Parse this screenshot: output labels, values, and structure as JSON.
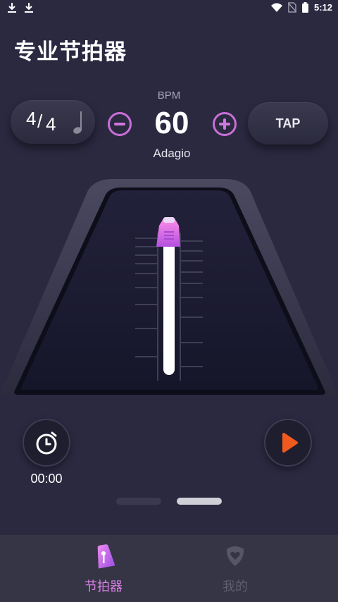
{
  "status_bar": {
    "left_icons": [
      "download-icon",
      "download-icon"
    ],
    "right_icons": [
      "wifi-icon",
      "no-sim-icon",
      "battery-icon"
    ],
    "time": "5:12"
  },
  "header": {
    "title": "专业节拍器"
  },
  "controls": {
    "time_signature": {
      "numerator": "4",
      "slash": "/",
      "denominator": "4",
      "icon": "quarter-note-icon"
    },
    "bpm_label": "BPM",
    "bpm_value": "60",
    "tempo_name": "Adagio",
    "decrease_icon": "minus-icon",
    "increase_icon": "plus-icon",
    "tap_label": "TAP"
  },
  "player": {
    "timer_icon": "stopwatch-icon",
    "timer_text": "00:00",
    "play_icon": "play-icon",
    "accent_color": "#f05a1e"
  },
  "pager": {
    "count": 2,
    "active_index": 1
  },
  "bottom_nav": {
    "items": [
      {
        "label": "节拍器",
        "icon": "metronome-icon",
        "active": true
      },
      {
        "label": "我的",
        "icon": "heart-shield-icon",
        "active": false
      }
    ],
    "active_color": "#d77fe4",
    "inactive_color": "#5f5f70"
  }
}
